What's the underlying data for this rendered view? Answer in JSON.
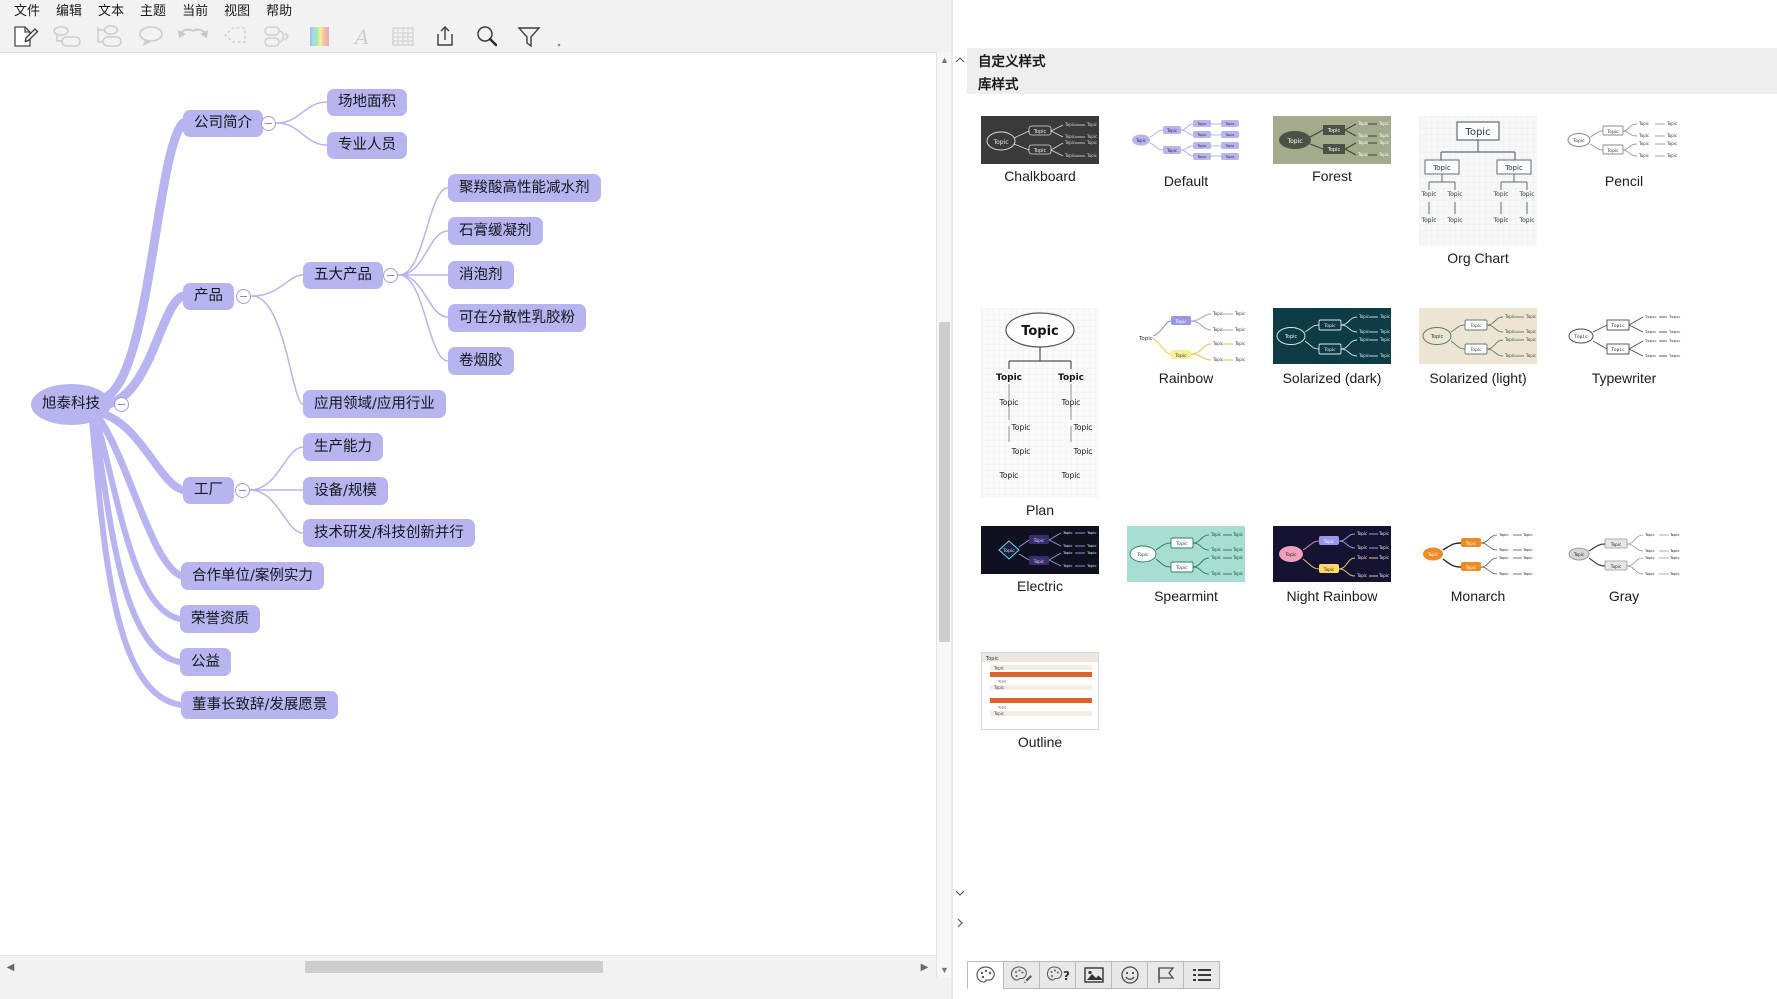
{
  "menu": {
    "items": [
      {
        "label": "文件",
        "name": "menu-file"
      },
      {
        "label": "编辑",
        "name": "menu-edit"
      },
      {
        "label": "文本",
        "name": "menu-text"
      },
      {
        "label": "主题",
        "name": "menu-theme"
      },
      {
        "label": "当前",
        "name": "menu-current"
      },
      {
        "label": "视图",
        "name": "menu-view"
      },
      {
        "label": "帮助",
        "name": "menu-help"
      }
    ]
  },
  "toolbar": {
    "buttons": [
      {
        "icon": "new-document-icon",
        "label": "新建"
      },
      {
        "icon": "add-sibling-topic-icon",
        "label": "同级主题"
      },
      {
        "icon": "add-child-topic-icon",
        "label": "子主题"
      },
      {
        "icon": "callout-icon",
        "label": "标注"
      },
      {
        "icon": "undo-redo-icon",
        "label": "撤销重做"
      },
      {
        "icon": "boundary-icon",
        "label": "边界"
      },
      {
        "icon": "relationship-icon",
        "label": "关系"
      },
      {
        "icon": "color-palette-icon",
        "label": "颜色"
      },
      {
        "icon": "font-icon",
        "label": "字体"
      },
      {
        "icon": "table-icon",
        "label": "表格"
      },
      {
        "icon": "export-icon",
        "label": "导出"
      },
      {
        "icon": "search-icon",
        "label": "搜索"
      },
      {
        "icon": "filter-icon",
        "label": "筛选"
      }
    ],
    "overflow": "more-options-icon"
  },
  "mindmap": {
    "root": {
      "label": "旭泰科技",
      "collapsed": false
    },
    "branches": [
      {
        "label": "公司简介",
        "children": [
          {
            "label": "场地面积"
          },
          {
            "label": "专业人员"
          }
        ]
      },
      {
        "label": "产品",
        "children": [
          {
            "label": "五大产品",
            "children": [
              {
                "label": "聚羧酸高性能减水剂"
              },
              {
                "label": "石膏缓凝剂"
              },
              {
                "label": "消泡剂"
              },
              {
                "label": "可在分散性乳胶粉"
              },
              {
                "label": "卷烟胶"
              }
            ]
          },
          {
            "label": "应用领域/应用行业"
          }
        ]
      },
      {
        "label": "工厂",
        "children": [
          {
            "label": "生产能力"
          },
          {
            "label": "设备/规模"
          },
          {
            "label": "技术研发/科技创新并行"
          }
        ]
      },
      {
        "label": "合作单位/案例实力",
        "children": []
      },
      {
        "label": "荣誉资质",
        "children": []
      },
      {
        "label": "公益",
        "children": []
      },
      {
        "label": "董事长致辞/发展愿景",
        "children": []
      }
    ],
    "node_fill": "#b7b4f0",
    "line_color": "#b7b4f0",
    "text_color": "#16161d"
  },
  "panel": {
    "headers": {
      "custom_styles": "自定义样式",
      "library_styles": "库样式"
    },
    "styles": [
      {
        "name": "Chalkboard",
        "bg": "#3a3a3a",
        "node": "#3a3a3a",
        "accent": "#e8e8e8",
        "text": "#e8e8e8",
        "shape": "dark"
      },
      {
        "name": "Default",
        "bg": "#ffffff",
        "node": "#b7b4f0",
        "accent": "#b7b4f0",
        "text": "#222222",
        "shape": "light"
      },
      {
        "name": "Forest",
        "bg": "#a3ab8c",
        "node": "#4a5246",
        "accent": "#ffffff",
        "text": "#ffffff",
        "shape": "dark"
      },
      {
        "name": "Org Chart",
        "bg": "#f7f7f7",
        "node": "#ffffff",
        "accent": "#5d6d7a",
        "text": "#2b3a44",
        "shape": "org"
      },
      {
        "name": "Pencil",
        "bg": "#ffffff",
        "node": "#ffffff",
        "accent": "#8a8a8a",
        "text": "#333333",
        "shape": "light"
      },
      {
        "name": "Plan",
        "bg": "#fafafa",
        "node": "#ffffff",
        "accent": "#555555",
        "text": "#111111",
        "shape": "plan"
      },
      {
        "name": "Rainbow",
        "bg": "#ffffff",
        "node": "#b7b4f0",
        "accent": "#7d79d6",
        "text": "#222222",
        "shape": "light"
      },
      {
        "name": "Solarized (dark)",
        "bg": "#0d3b46",
        "node": "#0d3b46",
        "accent": "#ffffff",
        "text": "#eeeeee",
        "shape": "dark"
      },
      {
        "name": "Solarized (light)",
        "bg": "#ece5d3",
        "node": "#ffffff",
        "accent": "#5c7a6e",
        "text": "#33403a",
        "shape": "light"
      },
      {
        "name": "Typewriter",
        "bg": "#ffffff",
        "node": "#ffffff",
        "accent": "#4a4a4a",
        "text": "#1a1a1a",
        "shape": "light"
      },
      {
        "name": "Electric",
        "bg": "#0f1020",
        "node": "#1b1d3a",
        "accent": "#6fd8ff",
        "text": "#e6e6ff",
        "shape": "dark"
      },
      {
        "name": "Spearmint",
        "bg": "#a8ded2",
        "node": "#ffffff",
        "accent": "#2e7d68",
        "text": "#17463c",
        "shape": "light"
      },
      {
        "name": "Night Rainbow",
        "bg": "#141432",
        "node": "#f0a0b8",
        "accent": "#ffd966",
        "text": "#ffffff",
        "shape": "dark"
      },
      {
        "name": "Monarch",
        "bg": "#ffffff",
        "node": "#f08a24",
        "accent": "#2a2a2a",
        "text": "#1a1a1a",
        "shape": "light"
      },
      {
        "name": "Gray",
        "bg": "#ffffff",
        "node": "#d6d6d6",
        "accent": "#4a4a4a",
        "text": "#222222",
        "shape": "light"
      },
      {
        "name": "Outline",
        "bg": "#ffffff",
        "node": "#e06030",
        "accent": "#e06030",
        "text": "#333333",
        "shape": "outline"
      }
    ],
    "thumbnail_topic_label": "Topic",
    "tabs": [
      {
        "name": "style-tab",
        "icon": "palette-icon",
        "active": true
      },
      {
        "name": "style-edit-tab",
        "icon": "palette-wrench-icon",
        "active": false
      },
      {
        "name": "style-help-tab",
        "icon": "palette-question-icon",
        "active": false
      },
      {
        "name": "image-tab",
        "icon": "picture-icon",
        "active": false
      },
      {
        "name": "emoji-tab",
        "icon": "smiley-icon",
        "active": false
      },
      {
        "name": "marker-tab",
        "icon": "flag-icon",
        "active": false
      },
      {
        "name": "outline-tab",
        "icon": "list-icon",
        "active": false
      }
    ]
  },
  "scrollbars": {
    "canvas_vertical": {
      "up": "▲",
      "down": "▼"
    },
    "canvas_horizontal": {
      "left": "◀",
      "right": "▶"
    },
    "panel_chevron_up": "︿",
    "panel_chevron_down": "﹀",
    "panel_chevron_right": "〉"
  }
}
